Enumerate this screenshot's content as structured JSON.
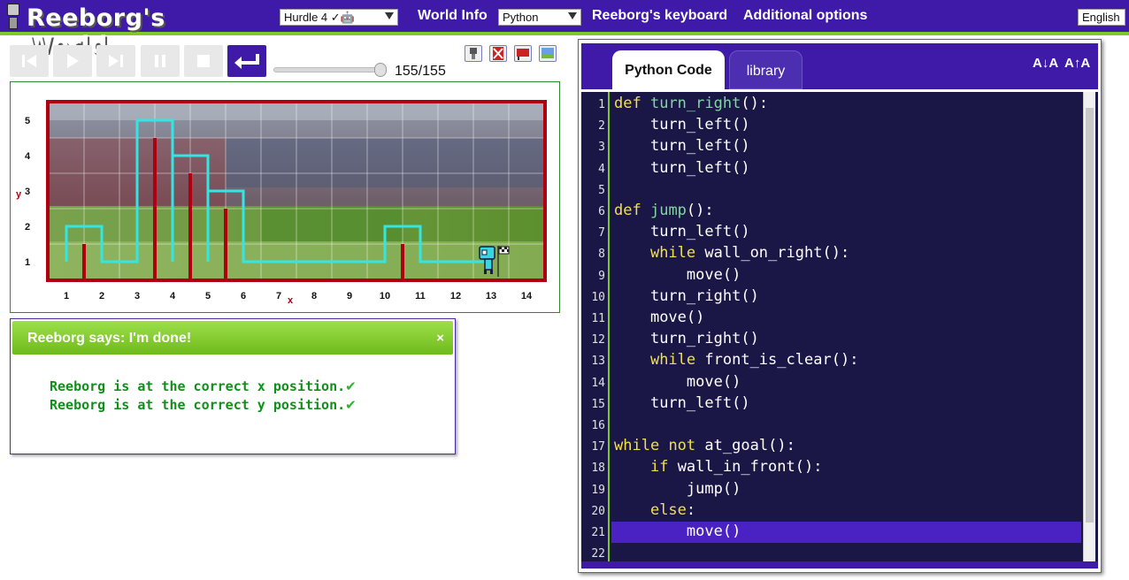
{
  "app": {
    "title": "Reeborg's World"
  },
  "topbar": {
    "world_select": "Hurdle 4 ✓🤖",
    "world_info": "World Info",
    "language_select": "Python",
    "keyboard": "Reeborg's keyboard",
    "additional": "Additional options",
    "ui_language": "English"
  },
  "controls": {
    "step_counter": "155/155",
    "progress": 1.0
  },
  "world": {
    "x_axis_label": "x",
    "y_axis_label": "y",
    "x_ticks": [
      "1",
      "2",
      "3",
      "4",
      "5",
      "6",
      "7",
      "8",
      "9",
      "10",
      "11",
      "12",
      "13",
      "14"
    ],
    "y_ticks": [
      "1",
      "2",
      "3",
      "4",
      "5"
    ]
  },
  "dialog": {
    "title": "Reeborg says: I'm done!",
    "close": "×",
    "messages": [
      "Reeborg is at the correct x position.",
      "Reeborg is at the correct y position."
    ],
    "check": "✔"
  },
  "editor": {
    "tab_code": "Python Code",
    "tab_library": "library",
    "font_decrease": "A↓A",
    "font_increase": "A↑A",
    "line_numbers": [
      "1",
      "2",
      "3",
      "4",
      "5",
      "6",
      "7",
      "8",
      "9",
      "10",
      "11",
      "12",
      "13",
      "14",
      "15",
      "16",
      "17",
      "18",
      "19",
      "20",
      "21",
      "22"
    ],
    "lines": [
      "def turn_right():",
      "    turn_left()",
      "    turn_left()",
      "    turn_left()",
      "",
      "def jump():",
      "    turn_left()",
      "    while wall_on_right():",
      "        move()",
      "    turn_right()",
      "    move()",
      "    turn_right()",
      "    while front_is_clear():",
      "        move()",
      "    turn_left()",
      "",
      "while not at_goal():",
      "    if wall_in_front():",
      "        jump()",
      "    else:",
      "        move()",
      ""
    ],
    "highlighted_line": 21
  },
  "colors": {
    "accent": "#3f1aa8",
    "green": "#7ec82a",
    "wall": "#b00010",
    "trace": "#33e6e6",
    "keyword": "#f0e050",
    "function": "#7fd8a0"
  }
}
